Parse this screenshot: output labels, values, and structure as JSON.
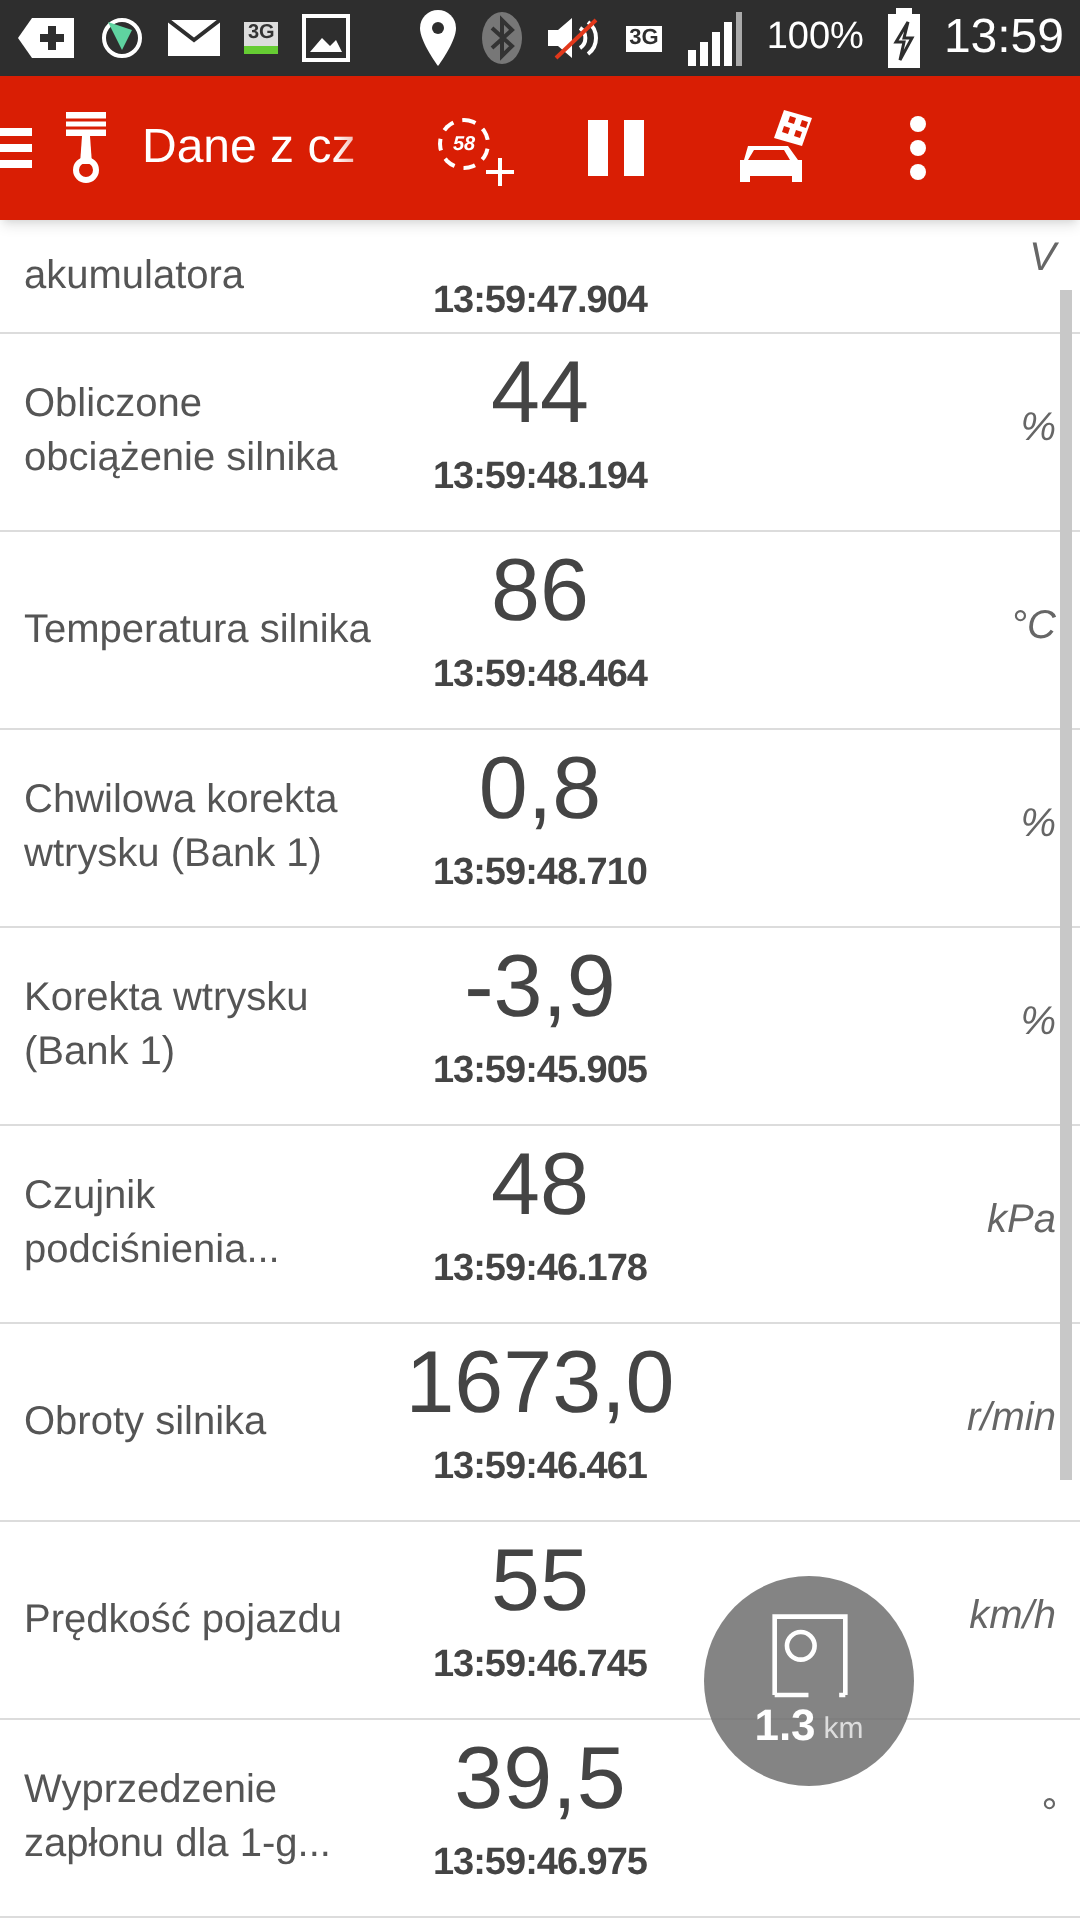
{
  "status_bar": {
    "network_badge": "3G",
    "data_badge": "3G",
    "battery": "100%",
    "time": "13:59"
  },
  "toolbar": {
    "title": "Dane z cz",
    "gauge_badge": "58"
  },
  "rows": [
    {
      "kind": "clipped",
      "label": "akumulatora",
      "time": "13:59:47.904",
      "unit": "V"
    },
    {
      "kind": "full",
      "label": "Obliczone obciążenie silnika",
      "value": "44",
      "time": "13:59:48.194",
      "unit": "%"
    },
    {
      "kind": "full",
      "label": "Temperatura silnika",
      "value": "86",
      "time": "13:59:48.464",
      "unit": "°C"
    },
    {
      "kind": "full",
      "label": "Chwilowa korekta wtrysku (Bank 1)",
      "value": "0,8",
      "time": "13:59:48.710",
      "unit": "%"
    },
    {
      "kind": "full",
      "label": "Korekta wtrysku (Bank 1)",
      "value": "-3,9",
      "time": "13:59:45.905",
      "unit": "%"
    },
    {
      "kind": "full",
      "label": "Czujnik podciśnienia...",
      "value": "48",
      "time": "13:59:46.178",
      "unit": "kPa"
    },
    {
      "kind": "full",
      "label": "Obroty silnika",
      "value": "1673,0",
      "time": "13:59:46.461",
      "unit": "r/min"
    },
    {
      "kind": "full",
      "label": "Prędkość pojazdu",
      "value": "55",
      "time": "13:59:46.745",
      "unit": "km/h"
    },
    {
      "kind": "full",
      "label": "Wyprzedzenie zapłonu dla 1-g...",
      "value": "39,5",
      "time": "13:59:46.975",
      "unit": "°"
    }
  ],
  "trip_bubble": {
    "distance": "1.3",
    "unit": "km"
  }
}
